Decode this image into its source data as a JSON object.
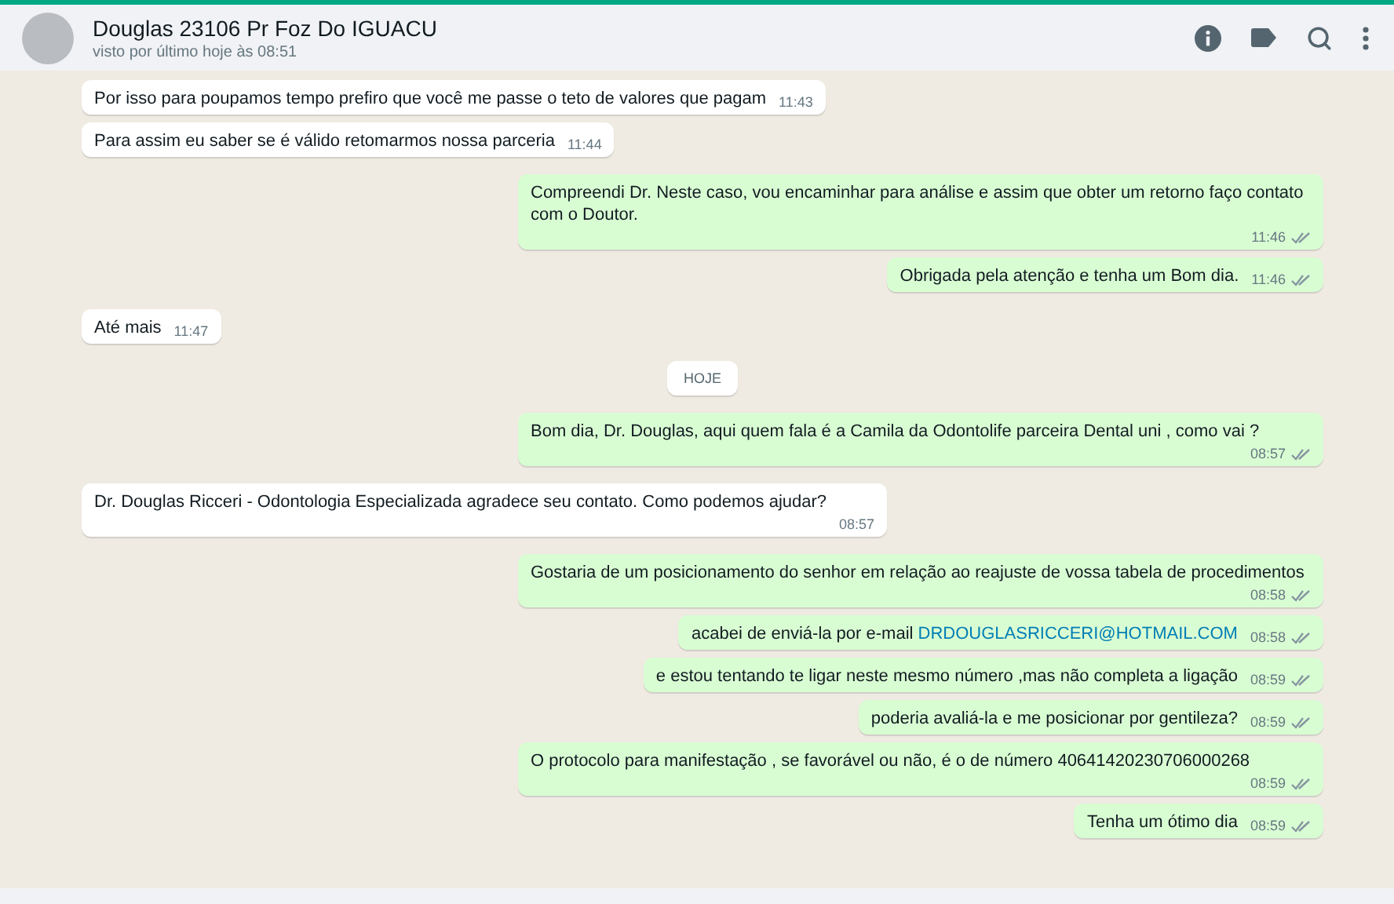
{
  "header": {
    "title": "Douglas 23106 Pr Foz Do IGUACU",
    "subtitle": "visto por último hoje às 08:51"
  },
  "messages": [
    {
      "kind": "in",
      "text": "Por isso para poupamos tempo prefiro que você me passe o teto de valores que pagam",
      "time": "11:43"
    },
    {
      "kind": "in",
      "text": "Para assim eu saber se é válido retomarmos nossa parceria",
      "time": "11:44"
    },
    {
      "kind": "out",
      "text": "Compreendi Dr. Neste caso, vou encaminhar para análise e assim que obter um retorno faço contato com o Doutor.",
      "time": "11:46",
      "read": false
    },
    {
      "kind": "out",
      "text": "Obrigada pela atenção e tenha um Bom dia.",
      "time": "11:46",
      "read": false
    },
    {
      "kind": "in",
      "text": "Até mais",
      "time": "11:47"
    },
    {
      "kind": "date",
      "text": "HOJE"
    },
    {
      "kind": "out",
      "text": "Bom dia, Dr. Douglas, aqui quem fala é a Camila da Odontolife parceira Dental uni , como vai ?",
      "time": "08:57",
      "read": false
    },
    {
      "kind": "in",
      "text": "Dr. Douglas Ricceri - Odontologia Especializada agradece seu contato. Como podemos ajudar?",
      "time": "08:57"
    },
    {
      "kind": "out",
      "text": "Gostaria de um posicionamento do senhor em relação ao reajuste de vossa tabela de procedimentos",
      "time": "08:58",
      "read": false
    },
    {
      "kind": "out",
      "text": "acabei de enviá-la por e-mail",
      "link": "DRDOUGLASRICCERI@HOTMAIL.COM",
      "time": "08:58",
      "read": false
    },
    {
      "kind": "out",
      "text": "e estou tentando te ligar neste mesmo número ,mas não completa a ligação",
      "time": "08:59",
      "read": false
    },
    {
      "kind": "out",
      "text": "poderia avaliá-la e me posicionar por gentileza?",
      "time": "08:59",
      "read": false
    },
    {
      "kind": "out",
      "text": "O protocolo para manifestação , se favorável ou não, é o de número 40641420230706000268",
      "time": "08:59",
      "read": false
    },
    {
      "kind": "out",
      "text": "Tenha um ótimo dia",
      "time": "08:59",
      "read": false
    }
  ]
}
